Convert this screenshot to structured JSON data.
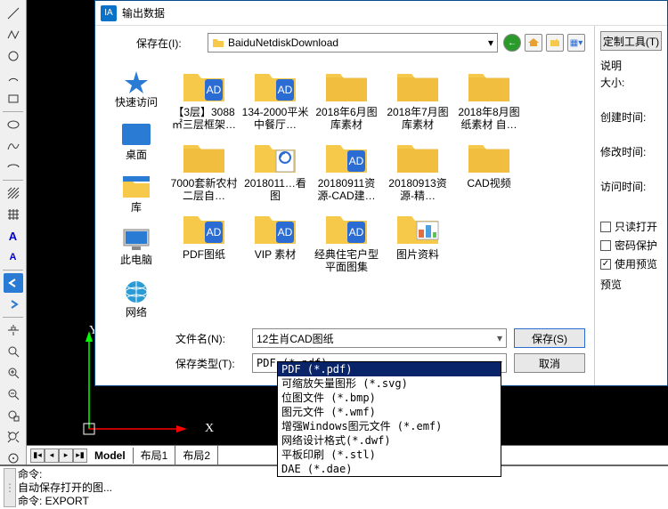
{
  "dialog": {
    "title": "输出数据",
    "save_in_label": "保存在(I):",
    "path": "BaiduNetdiskDownload",
    "filename_label": "文件名(N):",
    "filename_value": "12生肖CAD图纸",
    "save_type_label": "保存类型(T):",
    "save_type_value": "PDF (*.pdf)",
    "save_btn": "保存(S)",
    "cancel_btn": "取消",
    "custom_tools_btn": "定制工具(T)"
  },
  "places": [
    {
      "name": "快速访问"
    },
    {
      "name": "桌面"
    },
    {
      "name": "库"
    },
    {
      "name": "此电脑"
    },
    {
      "name": "网络"
    }
  ],
  "folders": [
    [
      {
        "name": "【3层】3088㎡三层框架…",
        "type": "cad"
      },
      {
        "name": "134-2000平米中餐厅…",
        "type": "cad"
      },
      {
        "name": "2018年6月图库素材",
        "type": "folder"
      },
      {
        "name": "2018年7月图库素材",
        "type": "folder"
      },
      {
        "name": "2018年8月图纸素材 自…",
        "type": "folder"
      }
    ],
    [
      {
        "name": "7000套新农村二层自…",
        "type": "folder"
      },
      {
        "name": "2018011…看图",
        "type": "pdf"
      },
      {
        "name": "20180911资源-CAD建…",
        "type": "cad"
      },
      {
        "name": "20180913资源-精…",
        "type": "folder"
      },
      {
        "name": "CAD视频",
        "type": "folder"
      }
    ],
    [
      {
        "name": "PDF图纸",
        "type": "cad"
      },
      {
        "name": "VIP 素材",
        "type": "cad"
      },
      {
        "name": "经典住宅户型平面图集",
        "type": "cad"
      },
      {
        "name": "图片资料",
        "type": "img"
      }
    ]
  ],
  "type_options": [
    "PDF (*.pdf)",
    "可缩放矢量图形 (*.svg)",
    "位图文件 (*.bmp)",
    "图元文件 (*.wmf)",
    "增强Windows图元文件 (*.emf)",
    "网络设计格式(*.dwf)",
    "平板印刷 (*.stl)",
    "DAE (*.dae)"
  ],
  "side": {
    "desc_label": "说明",
    "size_label": "大小:",
    "created_label": "创建时间:",
    "modified_label": "修改时间:",
    "accessed_label": "访问时间:",
    "readonly": "只读打开",
    "password": "密码保护",
    "preview_cb": "使用预览",
    "preview_label": "预览"
  },
  "tabs": {
    "model": "Model",
    "layout1": "布局1",
    "layout2": "布局2"
  },
  "cmd": {
    "l1": "命令:",
    "l2": "自动保存打开的图...",
    "l3": "命令: EXPORT"
  },
  "ucs": {
    "x": "X",
    "y": "Y"
  }
}
